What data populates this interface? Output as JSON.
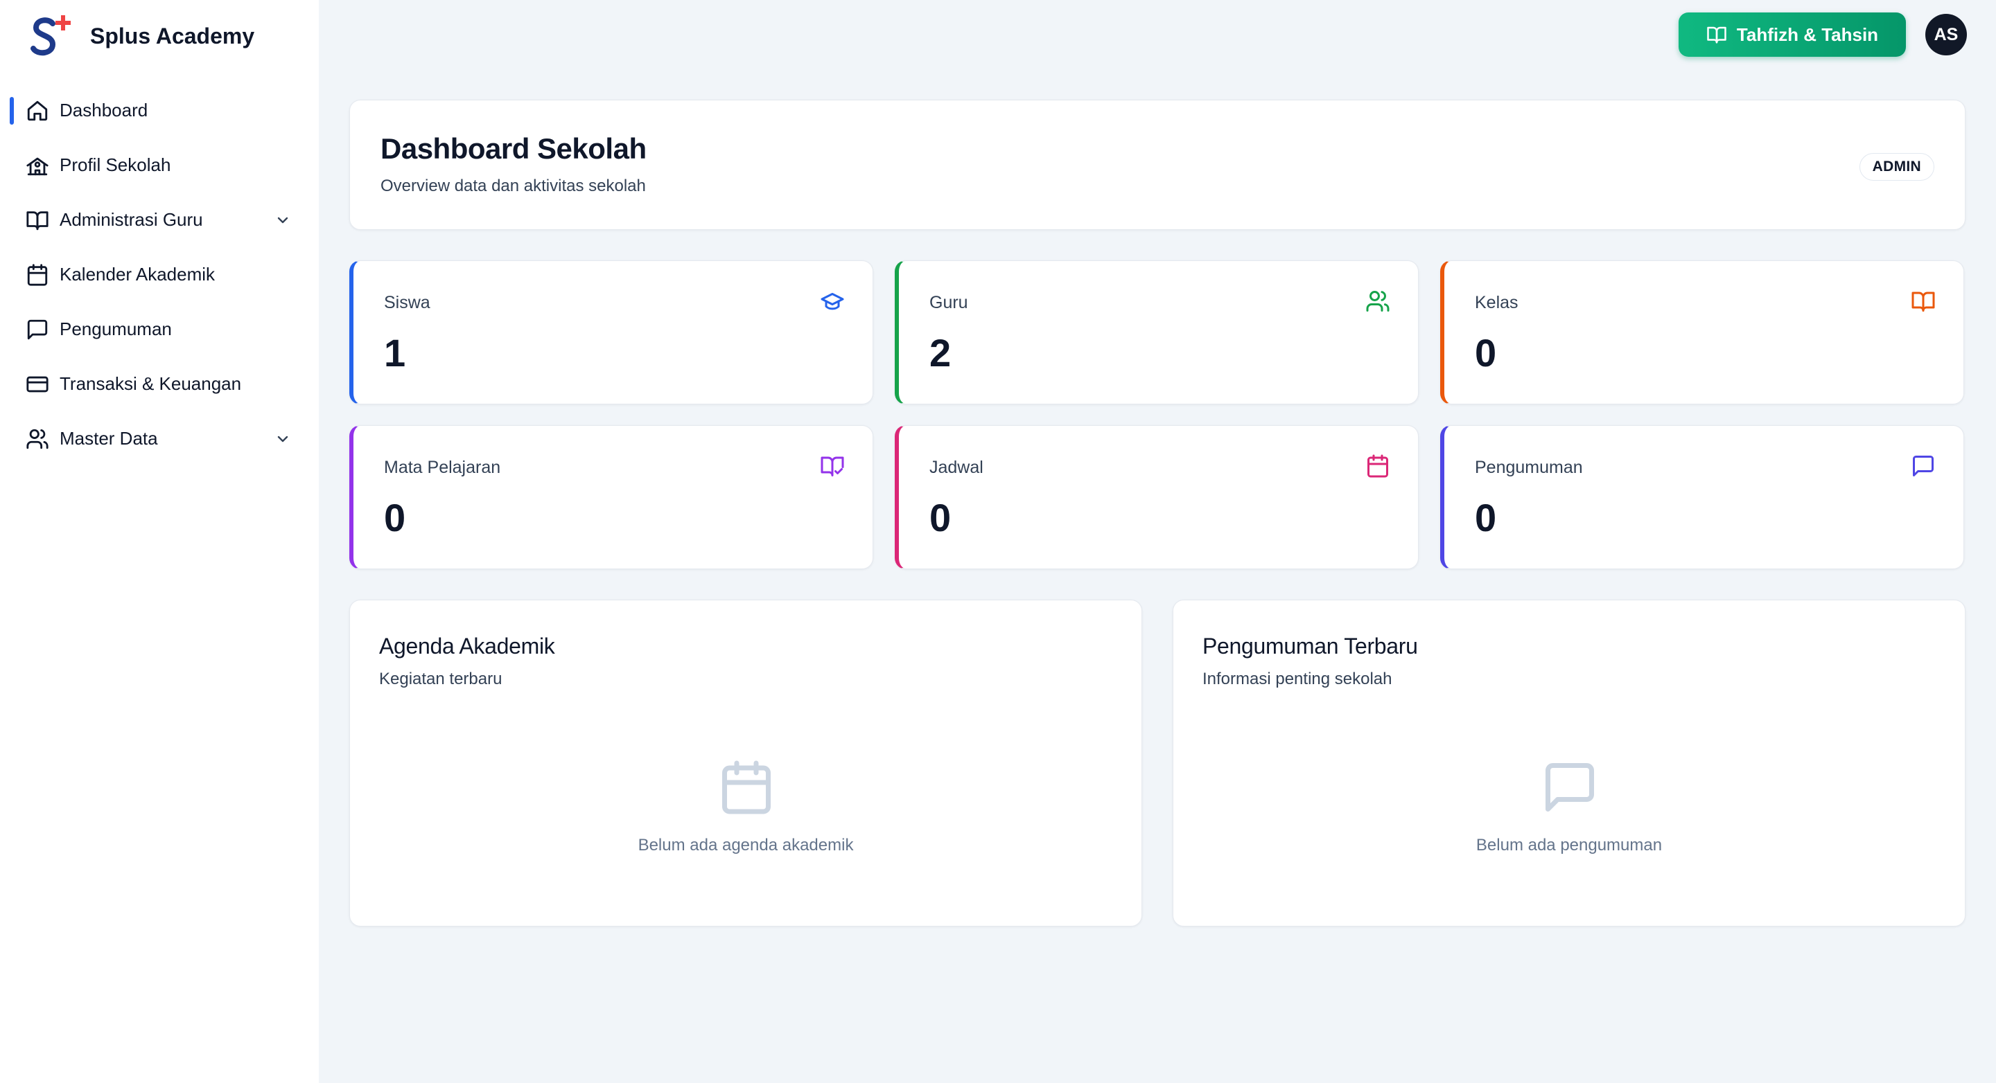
{
  "brand": {
    "name": "Splus Academy"
  },
  "sidebar": {
    "items": [
      {
        "label": "Dashboard",
        "icon": "home-icon",
        "active": true
      },
      {
        "label": "Profil Sekolah",
        "icon": "school-icon"
      },
      {
        "label": "Administrasi Guru",
        "icon": "book-open-icon",
        "expandable": true
      },
      {
        "label": "Kalender Akademik",
        "icon": "calendar-icon"
      },
      {
        "label": "Pengumuman",
        "icon": "message-square-icon"
      },
      {
        "label": "Transaksi & Keuangan",
        "icon": "credit-card-icon"
      },
      {
        "label": "Master Data",
        "icon": "users-icon",
        "expandable": true
      }
    ]
  },
  "topbar": {
    "tahfizh_button": "Tahfizh & Tahsin",
    "avatar_initials": "AS"
  },
  "header": {
    "title": "Dashboard Sekolah",
    "subtitle": "Overview data dan aktivitas sekolah",
    "role_badge": "ADMIN"
  },
  "stats": [
    {
      "label": "Siswa",
      "value": "1",
      "icon": "graduation-cap-icon",
      "color": "#2563eb"
    },
    {
      "label": "Guru",
      "value": "2",
      "icon": "users-icon",
      "color": "#16a34a"
    },
    {
      "label": "Kelas",
      "value": "0",
      "icon": "book-open-icon",
      "color": "#ea580c"
    },
    {
      "label": "Mata Pelajaran",
      "value": "0",
      "icon": "book-check-icon",
      "color": "#9333ea"
    },
    {
      "label": "Jadwal",
      "value": "0",
      "icon": "calendar-icon",
      "color": "#db2777"
    },
    {
      "label": "Pengumuman",
      "value": "0",
      "icon": "message-square-icon",
      "color": "#4f46e5"
    }
  ],
  "agenda": {
    "title": "Agenda Akademik",
    "subtitle": "Kegiatan terbaru",
    "empty_text": "Belum ada agenda akademik"
  },
  "announcements": {
    "title": "Pengumuman Terbaru",
    "subtitle": "Informasi penting sekolah",
    "empty_text": "Belum ada pengumuman"
  },
  "colors": {
    "accent": "#2563eb",
    "button_green": "#059669",
    "background": "#f1f5f9"
  }
}
